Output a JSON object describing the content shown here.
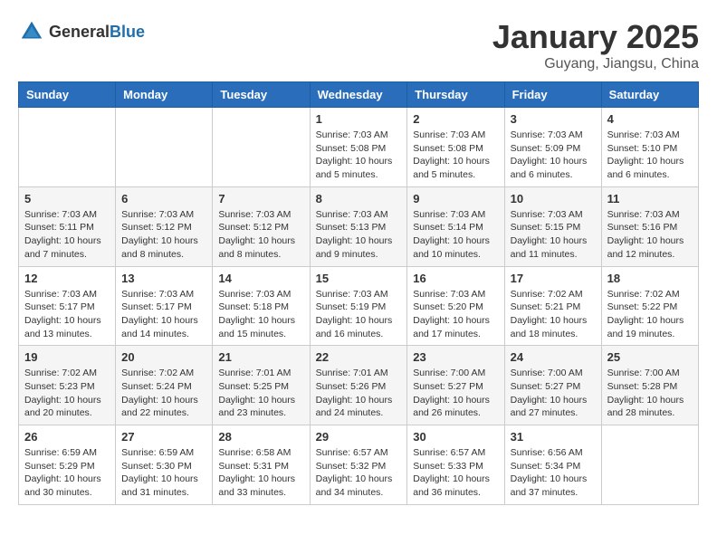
{
  "header": {
    "logo_general": "General",
    "logo_blue": "Blue",
    "month_title": "January 2025",
    "location": "Guyang, Jiangsu, China"
  },
  "days_of_week": [
    "Sunday",
    "Monday",
    "Tuesday",
    "Wednesday",
    "Thursday",
    "Friday",
    "Saturday"
  ],
  "weeks": [
    [
      {
        "day": "",
        "info": ""
      },
      {
        "day": "",
        "info": ""
      },
      {
        "day": "",
        "info": ""
      },
      {
        "day": "1",
        "info": "Sunrise: 7:03 AM\nSunset: 5:08 PM\nDaylight: 10 hours\nand 5 minutes."
      },
      {
        "day": "2",
        "info": "Sunrise: 7:03 AM\nSunset: 5:08 PM\nDaylight: 10 hours\nand 5 minutes."
      },
      {
        "day": "3",
        "info": "Sunrise: 7:03 AM\nSunset: 5:09 PM\nDaylight: 10 hours\nand 6 minutes."
      },
      {
        "day": "4",
        "info": "Sunrise: 7:03 AM\nSunset: 5:10 PM\nDaylight: 10 hours\nand 6 minutes."
      }
    ],
    [
      {
        "day": "5",
        "info": "Sunrise: 7:03 AM\nSunset: 5:11 PM\nDaylight: 10 hours\nand 7 minutes."
      },
      {
        "day": "6",
        "info": "Sunrise: 7:03 AM\nSunset: 5:12 PM\nDaylight: 10 hours\nand 8 minutes."
      },
      {
        "day": "7",
        "info": "Sunrise: 7:03 AM\nSunset: 5:12 PM\nDaylight: 10 hours\nand 8 minutes."
      },
      {
        "day": "8",
        "info": "Sunrise: 7:03 AM\nSunset: 5:13 PM\nDaylight: 10 hours\nand 9 minutes."
      },
      {
        "day": "9",
        "info": "Sunrise: 7:03 AM\nSunset: 5:14 PM\nDaylight: 10 hours\nand 10 minutes."
      },
      {
        "day": "10",
        "info": "Sunrise: 7:03 AM\nSunset: 5:15 PM\nDaylight: 10 hours\nand 11 minutes."
      },
      {
        "day": "11",
        "info": "Sunrise: 7:03 AM\nSunset: 5:16 PM\nDaylight: 10 hours\nand 12 minutes."
      }
    ],
    [
      {
        "day": "12",
        "info": "Sunrise: 7:03 AM\nSunset: 5:17 PM\nDaylight: 10 hours\nand 13 minutes."
      },
      {
        "day": "13",
        "info": "Sunrise: 7:03 AM\nSunset: 5:17 PM\nDaylight: 10 hours\nand 14 minutes."
      },
      {
        "day": "14",
        "info": "Sunrise: 7:03 AM\nSunset: 5:18 PM\nDaylight: 10 hours\nand 15 minutes."
      },
      {
        "day": "15",
        "info": "Sunrise: 7:03 AM\nSunset: 5:19 PM\nDaylight: 10 hours\nand 16 minutes."
      },
      {
        "day": "16",
        "info": "Sunrise: 7:03 AM\nSunset: 5:20 PM\nDaylight: 10 hours\nand 17 minutes."
      },
      {
        "day": "17",
        "info": "Sunrise: 7:02 AM\nSunset: 5:21 PM\nDaylight: 10 hours\nand 18 minutes."
      },
      {
        "day": "18",
        "info": "Sunrise: 7:02 AM\nSunset: 5:22 PM\nDaylight: 10 hours\nand 19 minutes."
      }
    ],
    [
      {
        "day": "19",
        "info": "Sunrise: 7:02 AM\nSunset: 5:23 PM\nDaylight: 10 hours\nand 20 minutes."
      },
      {
        "day": "20",
        "info": "Sunrise: 7:02 AM\nSunset: 5:24 PM\nDaylight: 10 hours\nand 22 minutes."
      },
      {
        "day": "21",
        "info": "Sunrise: 7:01 AM\nSunset: 5:25 PM\nDaylight: 10 hours\nand 23 minutes."
      },
      {
        "day": "22",
        "info": "Sunrise: 7:01 AM\nSunset: 5:26 PM\nDaylight: 10 hours\nand 24 minutes."
      },
      {
        "day": "23",
        "info": "Sunrise: 7:00 AM\nSunset: 5:27 PM\nDaylight: 10 hours\nand 26 minutes."
      },
      {
        "day": "24",
        "info": "Sunrise: 7:00 AM\nSunset: 5:27 PM\nDaylight: 10 hours\nand 27 minutes."
      },
      {
        "day": "25",
        "info": "Sunrise: 7:00 AM\nSunset: 5:28 PM\nDaylight: 10 hours\nand 28 minutes."
      }
    ],
    [
      {
        "day": "26",
        "info": "Sunrise: 6:59 AM\nSunset: 5:29 PM\nDaylight: 10 hours\nand 30 minutes."
      },
      {
        "day": "27",
        "info": "Sunrise: 6:59 AM\nSunset: 5:30 PM\nDaylight: 10 hours\nand 31 minutes."
      },
      {
        "day": "28",
        "info": "Sunrise: 6:58 AM\nSunset: 5:31 PM\nDaylight: 10 hours\nand 33 minutes."
      },
      {
        "day": "29",
        "info": "Sunrise: 6:57 AM\nSunset: 5:32 PM\nDaylight: 10 hours\nand 34 minutes."
      },
      {
        "day": "30",
        "info": "Sunrise: 6:57 AM\nSunset: 5:33 PM\nDaylight: 10 hours\nand 36 minutes."
      },
      {
        "day": "31",
        "info": "Sunrise: 6:56 AM\nSunset: 5:34 PM\nDaylight: 10 hours\nand 37 minutes."
      },
      {
        "day": "",
        "info": ""
      }
    ]
  ]
}
